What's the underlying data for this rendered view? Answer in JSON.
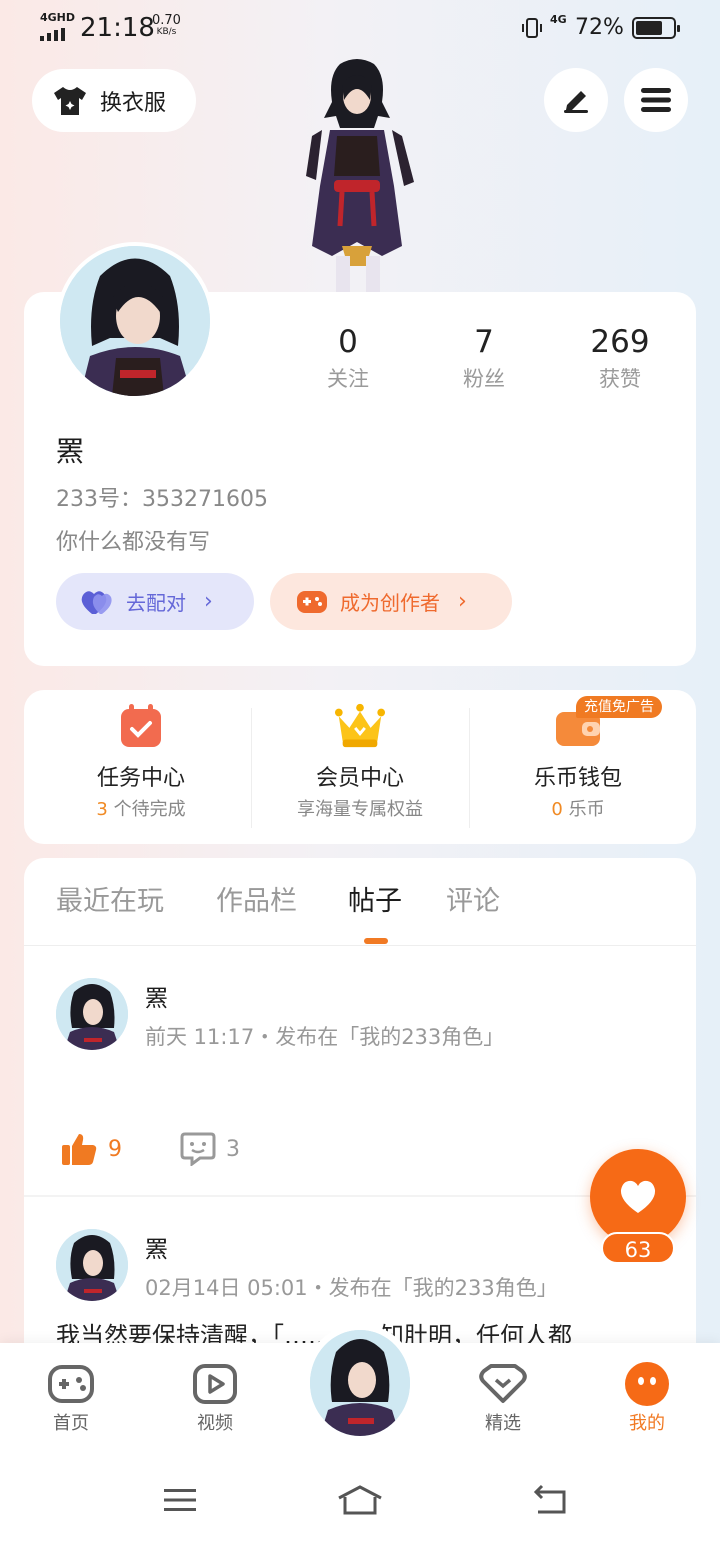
{
  "status_bar": {
    "network": "4GHD",
    "time": "21:18",
    "speed_value": "0.70",
    "speed_unit": "KB/s",
    "network2": "4G",
    "battery": "72%",
    "battery_level": 0.72
  },
  "header": {
    "outfit_label": "换衣服"
  },
  "profile": {
    "name": "罴",
    "id_text": "233号：353271605",
    "bio": "你什么都没有写",
    "stats": [
      {
        "value": "0",
        "label": "关注"
      },
      {
        "value": "7",
        "label": "粉丝"
      },
      {
        "value": "269",
        "label": "获赞"
      }
    ],
    "match_label": "去配对",
    "creator_label": "成为创作者"
  },
  "services": {
    "ad_tag": "充值免广告",
    "items": [
      {
        "title": "任务中心",
        "count": "3",
        "sub": "个待完成"
      },
      {
        "title": "会员中心",
        "sub": "享海量专属权益"
      },
      {
        "title": "乐币钱包",
        "count": "0",
        "sub": "乐币"
      }
    ]
  },
  "feed": {
    "tabs": [
      "最近在玩",
      "作品栏",
      "帖子",
      "评论"
    ],
    "active_tab": "帖子",
    "posts": [
      {
        "author": "罴",
        "meta": "前天 11:17・发布在「我的233角色」",
        "likes": "9",
        "comments": "3"
      },
      {
        "author": "罴",
        "meta": "02月14日 05:01・发布在「我的233角色」",
        "text": "我当然要保持清醒，「……」心知肚明，任何人都"
      }
    ]
  },
  "float_like": {
    "count": "63"
  },
  "bottom_nav": {
    "items": [
      {
        "label": "首页"
      },
      {
        "label": "视频"
      },
      {
        "label": "精选"
      },
      {
        "label": "我的"
      }
    ]
  },
  "colors": {
    "accent": "#f17a24",
    "match_purple": "#6568d8",
    "fab_orange": "#f66a16"
  }
}
